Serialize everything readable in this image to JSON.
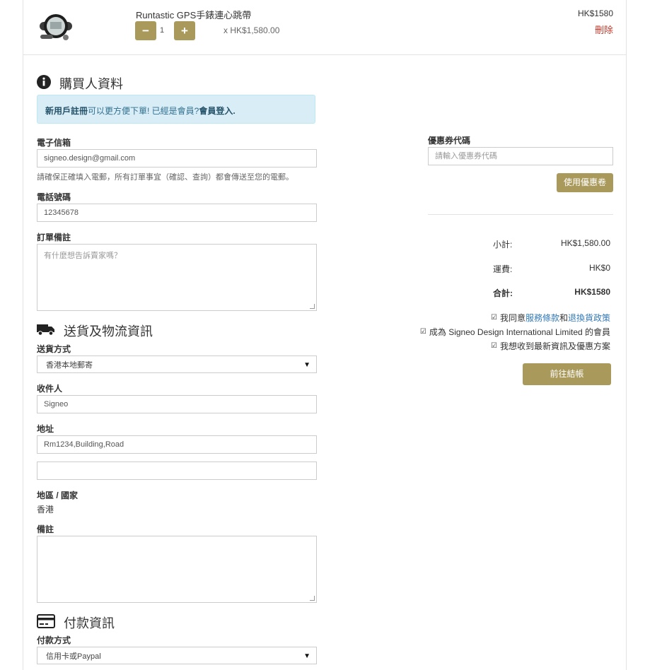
{
  "cart": {
    "product_name": "Runtastic GPS手錶連心跳帶",
    "quantity": "1",
    "minus_label": "−",
    "plus_label": "+",
    "unit_price": "x HK$1,580.00",
    "line_total": "HK$1580",
    "remove_label": "刪除"
  },
  "buyer": {
    "heading": "購買人資料",
    "notice_register": "新用戶註冊",
    "notice_mid": "可以更方便下單! 已經是會員?",
    "notice_login": "會員登入.",
    "email_label": "電子信箱",
    "email_value": "signeo.design@gmail.com",
    "email_hint": "請確保正確填入電郵，所有訂單事宜（確認、查詢）都會傳送至您的電郵。",
    "phone_label": "電話號碼",
    "phone_value": "12345678",
    "note_label": "訂單備註",
    "note_placeholder": "有什麼想告訴賣家嗎？"
  },
  "delivery": {
    "heading": "送貨及物流資訊",
    "method_label": "送貨方式",
    "method_value": "香港本地郵寄",
    "recipient_label": "收件人",
    "recipient_value": "Signeo",
    "address_label": "地址",
    "address_line1": "Rm1234,Building,Road",
    "address_line2": "",
    "region_label": "地區 / 國家",
    "region_value": "香港",
    "remarks_label": "備註"
  },
  "payment": {
    "heading": "付款資訊",
    "method_label": "付款方式",
    "method_value": "信用卡或Paypal"
  },
  "coupon": {
    "label": "優惠券代碼",
    "placeholder": "請輸入優惠券代碼",
    "apply_label": "使用優惠卷"
  },
  "summary": {
    "subtotal_label": "小計:",
    "subtotal_value": "HK$1,580.00",
    "shipping_label": "運費:",
    "shipping_value": "HK$0",
    "total_label": "合計:",
    "total_value": "HK$1580"
  },
  "agreements": {
    "terms_prefix": "我同意",
    "terms_link": "服務條款",
    "terms_and": "和",
    "return_link": "退換貨政策",
    "member_text": "成為 Signeo Design International Limited 的會員",
    "newsletter_text": "我想收到最新資訊及優惠方案"
  },
  "checkout_label": "前往結帳",
  "colors": {
    "accent": "#a99a5c",
    "info_bg": "#d9edf7",
    "link": "#337ab7",
    "remove": "#c0392b"
  }
}
